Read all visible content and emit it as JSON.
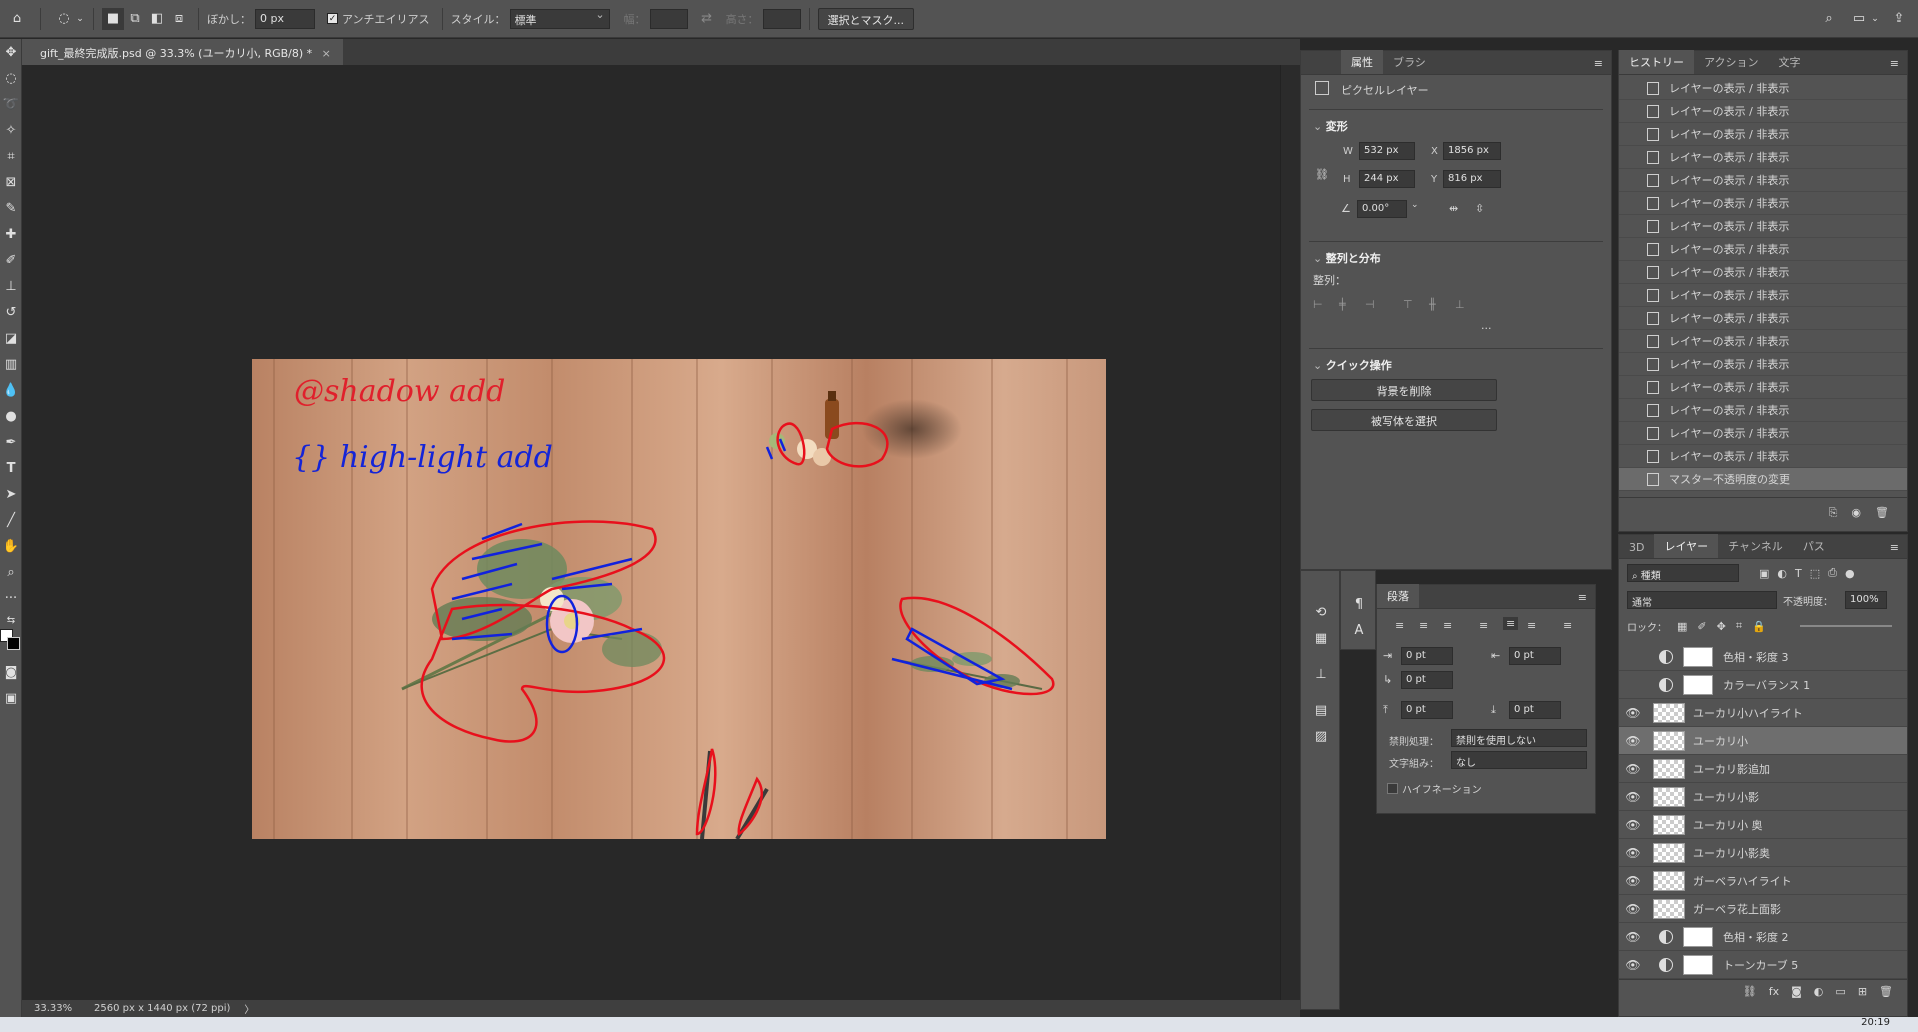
{
  "options_bar": {
    "feather_label": "ぼかし：",
    "feather_value": "0 px",
    "antialias_label": "アンチエイリアス",
    "style_label": "スタイル：",
    "style_value": "標準",
    "width_label": "幅：",
    "height_label": "高さ：",
    "select_mask_button": "選択とマスク..."
  },
  "document": {
    "tab_title": "gift_最終完成版.psd @ 33.3% (ユーカリ小, RGB/8) *",
    "close_glyph": "×",
    "zoom": "33.33%",
    "doc_size": "2560 px x 1440 px (72 ppi)",
    "status_arrow": "〉",
    "annotation_shadow": "@shadow add",
    "annotation_highlight": "{} high-light add"
  },
  "properties_panel": {
    "tabs": [
      "属性",
      "ブラシ"
    ],
    "layer_type": "ピクセルレイヤー",
    "transform_title": "変形",
    "w_label": "W",
    "w_value": "532 px",
    "h_label": "H",
    "h_value": "244 px",
    "x_label": "X",
    "x_value": "1856 px",
    "y_label": "Y",
    "y_value": "816 px",
    "angle_value": "0.00°",
    "align_title": "整列と分布",
    "align_label": "整列：",
    "more_glyph": "···",
    "quick_title": "クイック操作",
    "remove_bg_button": "背景を削除",
    "select_subject_button": "被写体を選択"
  },
  "paragraph_panel": {
    "tab": "段落",
    "indent_left": "0 pt",
    "indent_right": "0 pt",
    "indent_first": "0 pt",
    "space_before": "0 pt",
    "space_after": "0 pt",
    "kinsoku_label": "禁則処理：",
    "kinsoku_value": "禁則を使用しない",
    "mojikumi_label": "文字組み：",
    "mojikumi_value": "なし",
    "hyphenation_label": "ハイフネーション"
  },
  "history_panel": {
    "tabs": [
      "ヒストリー",
      "アクション",
      "文字"
    ],
    "items": [
      "レイヤーの表示 / 非表示",
      "レイヤーの表示 / 非表示",
      "レイヤーの表示 / 非表示",
      "レイヤーの表示 / 非表示",
      "レイヤーの表示 / 非表示",
      "レイヤーの表示 / 非表示",
      "レイヤーの表示 / 非表示",
      "レイヤーの表示 / 非表示",
      "レイヤーの表示 / 非表示",
      "レイヤーの表示 / 非表示",
      "レイヤーの表示 / 非表示",
      "レイヤーの表示 / 非表示",
      "レイヤーの表示 / 非表示",
      "レイヤーの表示 / 非表示",
      "レイヤーの表示 / 非表示",
      "レイヤーの表示 / 非表示",
      "レイヤーの表示 / 非表示",
      "マスター不透明度の変更"
    ]
  },
  "layers_panel": {
    "tabs": [
      "3D",
      "レイヤー",
      "チャンネル",
      "パス"
    ],
    "filter_value": "種類",
    "blend_mode": "通常",
    "opacity_label": "不透明度：",
    "opacity_value": "100%",
    "lock_label": "ロック：",
    "layers": [
      {
        "name": "色相・彩度 3",
        "visible": false,
        "kind": "adjustment"
      },
      {
        "name": "カラーバランス 1",
        "visible": false,
        "kind": "adjustment"
      },
      {
        "name": "ユーカリ小ハイライト",
        "visible": true,
        "kind": "pixel"
      },
      {
        "name": "ユーカリ小",
        "visible": true,
        "kind": "pixel",
        "selected": true
      },
      {
        "name": "ユーカリ影追加",
        "visible": true,
        "kind": "pixel"
      },
      {
        "name": "ユーカリ小影",
        "visible": true,
        "kind": "pixel"
      },
      {
        "name": "ユーカリ小 奥",
        "visible": true,
        "kind": "pixel"
      },
      {
        "name": "ユーカリ小影奥",
        "visible": true,
        "kind": "pixel"
      },
      {
        "name": "ガーベラハイライト",
        "visible": true,
        "kind": "pixel"
      },
      {
        "name": "ガーベラ花上面影",
        "visible": true,
        "kind": "pixel"
      },
      {
        "name": "色相・彩度 2",
        "visible": true,
        "kind": "adjustment"
      },
      {
        "name": "トーンカーブ 5",
        "visible": true,
        "kind": "adjustment"
      }
    ]
  },
  "taskbar": {
    "time": "20:19"
  }
}
